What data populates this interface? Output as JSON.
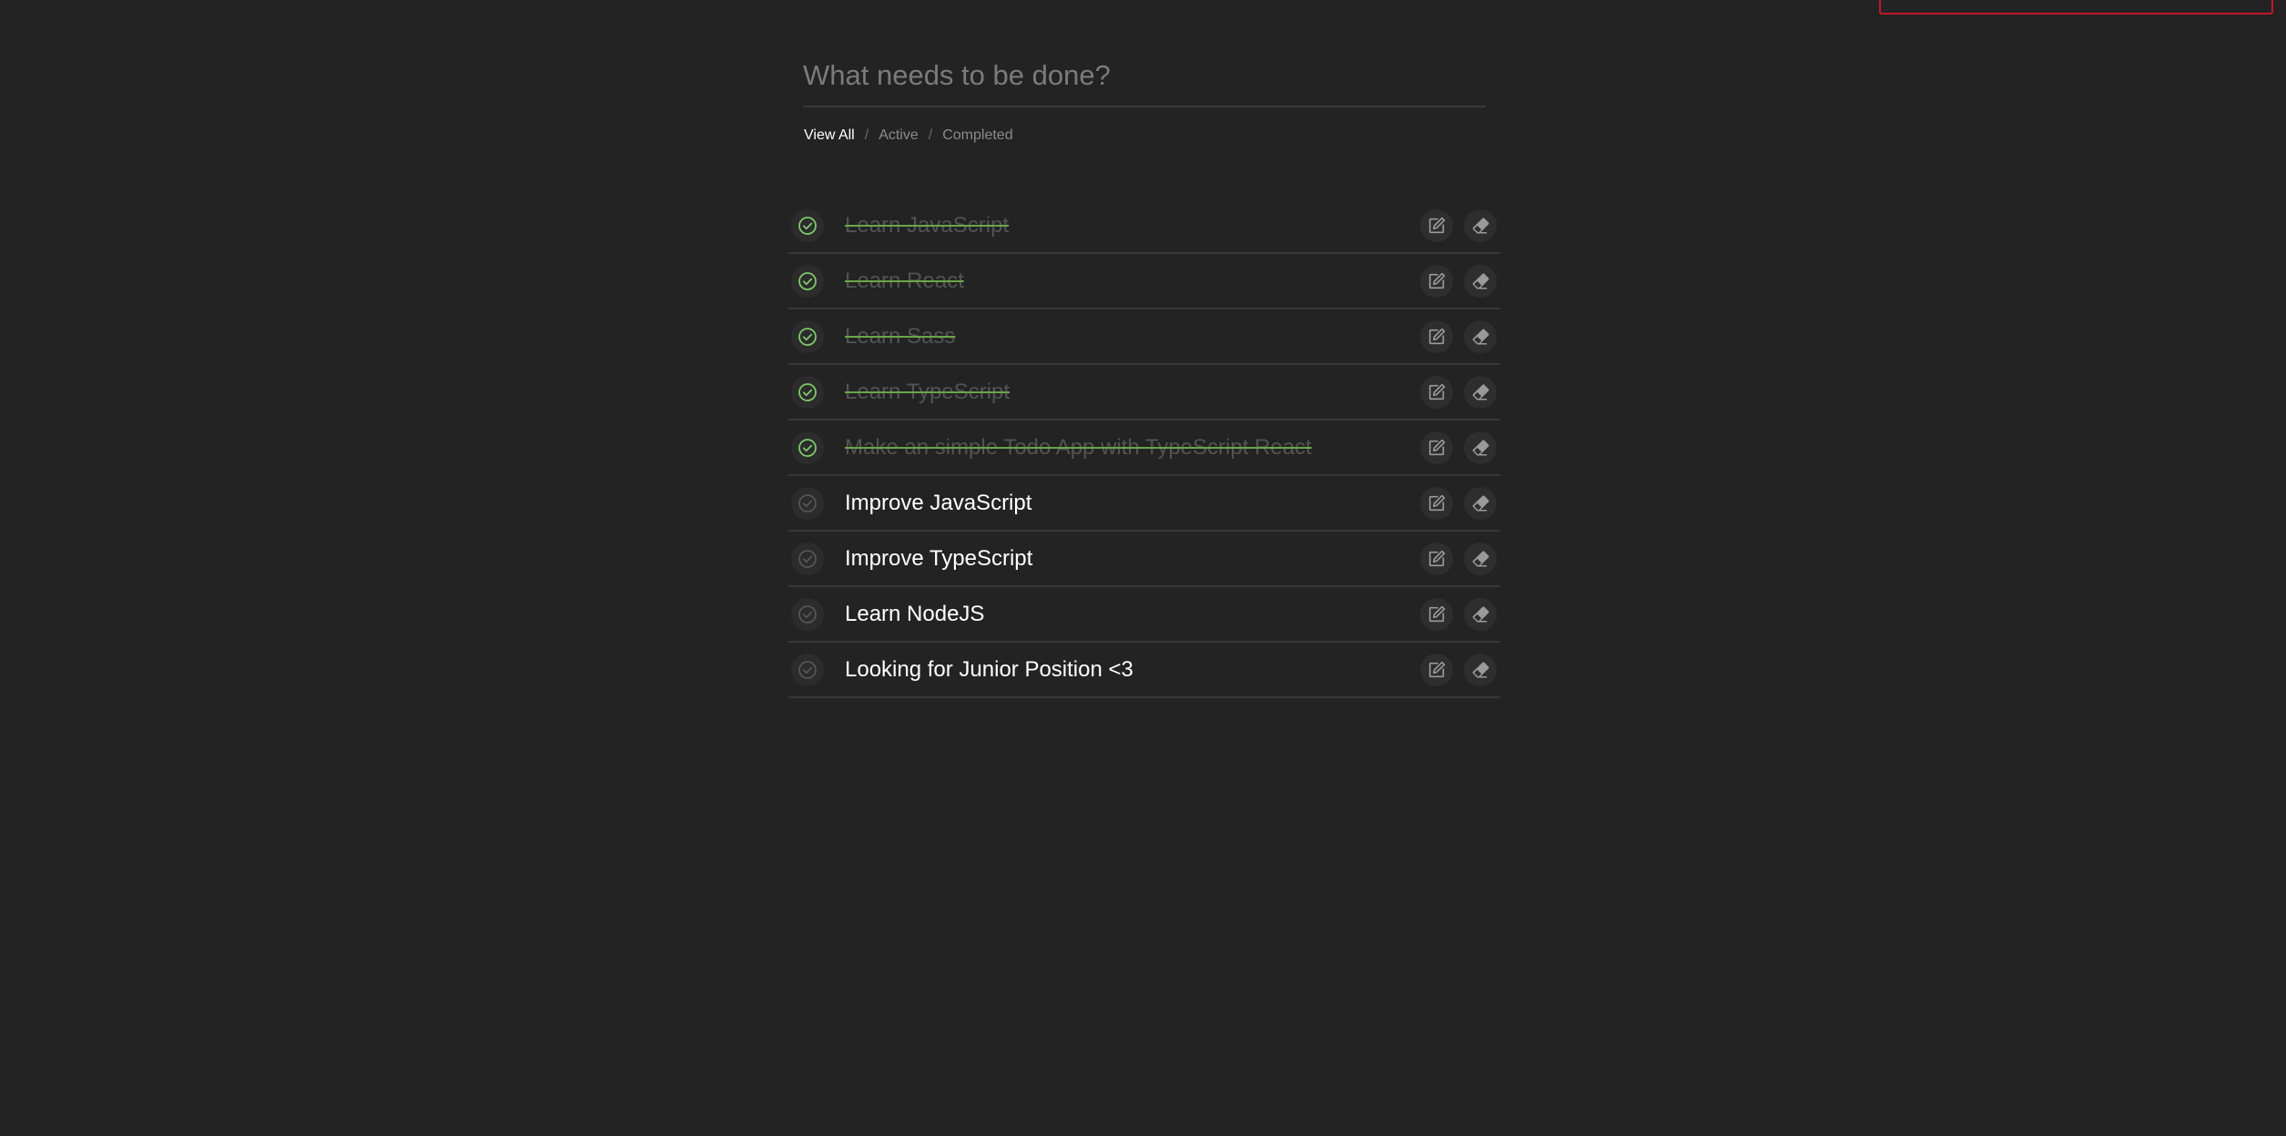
{
  "new_todo": {
    "placeholder": "What needs to be done?",
    "value": ""
  },
  "filters": {
    "view_all": "View All",
    "active": "Active",
    "completed": "Completed",
    "separator": "/",
    "selected": "View All"
  },
  "todos": [
    {
      "text": "Learn JavaScript",
      "completed": true
    },
    {
      "text": "Learn React",
      "completed": true
    },
    {
      "text": "Learn Sass",
      "completed": true
    },
    {
      "text": "Learn TypeScript",
      "completed": true
    },
    {
      "text": "Make an simple Todo App with TypeScript React",
      "completed": true
    },
    {
      "text": "Improve JavaScript",
      "completed": false
    },
    {
      "text": "Improve TypeScript",
      "completed": false
    },
    {
      "text": "Learn NodeJS",
      "completed": false
    },
    {
      "text": "Looking for Junior Position <3",
      "completed": false
    }
  ],
  "icons": {
    "check": "check-circle-icon",
    "edit": "edit-icon",
    "erase": "eraser-icon"
  },
  "colors": {
    "background": "#232323",
    "completed_check": "#7ec86a",
    "pending_check": "#555555",
    "strike": "#6ba54a",
    "corner_border": "#c4162a"
  }
}
